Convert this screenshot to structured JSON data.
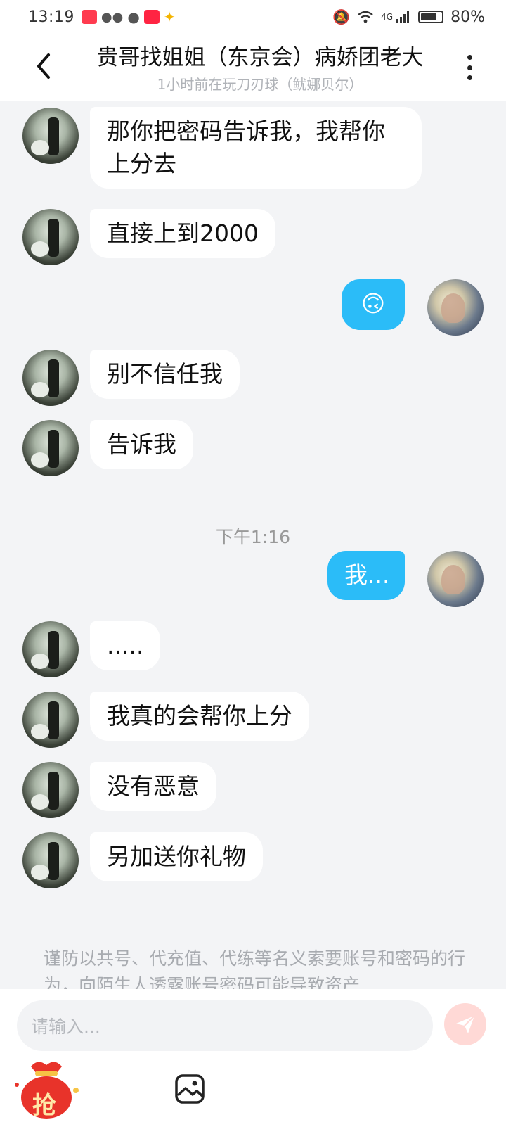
{
  "status_bar": {
    "time": "13:19",
    "battery": "80%",
    "network": "4G"
  },
  "header": {
    "title": "贵哥找姐姐（东京会）病娇团老大",
    "subtitle": "1小时前在玩刀刃球（鱿娜贝尔）"
  },
  "messages": [
    {
      "from": "other",
      "text": "那你把密码告诉我，我帮你上分去"
    },
    {
      "from": "other",
      "text": "直接上到2000"
    },
    {
      "from": "me",
      "text": "🙃"
    },
    {
      "from": "other",
      "text": "别不信任我"
    },
    {
      "from": "other",
      "text": "告诉我"
    },
    {
      "from": "me",
      "text": "我..."
    },
    {
      "from": "other",
      "text": "....."
    },
    {
      "from": "other",
      "text": "我真的会帮你上分"
    },
    {
      "from": "other",
      "text": "没有恶意"
    },
    {
      "from": "other",
      "text": "另加送你礼物"
    }
  ],
  "time_separator": "下午1:16",
  "warning": "谨防以共号、代充值、代练等名义索要账号和密码的行为，向陌生人透露账号密码可能导致资产",
  "input": {
    "placeholder": "请输入..."
  },
  "toolbar": {
    "grab_label": "抢"
  },
  "colors": {
    "my_bubble": "#2bbcf8",
    "background": "#f3f4f6",
    "send_button": "#ffd9d6"
  }
}
